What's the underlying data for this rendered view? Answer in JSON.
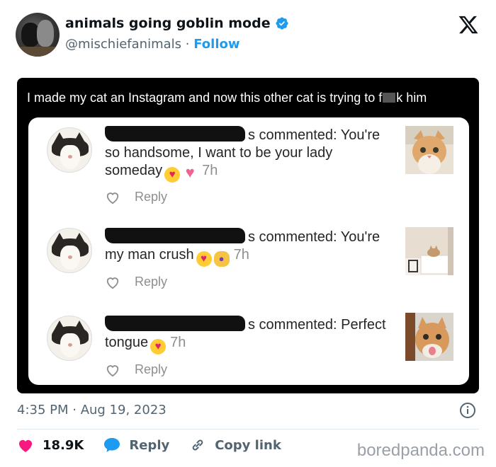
{
  "tweet": {
    "display_name": "animals going goblin mode",
    "handle": "@mischiefanimals",
    "separator": "·",
    "follow_label": "Follow",
    "timestamp": "4:35 PM · Aug 19, 2023",
    "likes": "18.9K",
    "reply_label": "Reply",
    "copy_link_label": "Copy link",
    "watermark": "boredpanda.com"
  },
  "media": {
    "title_before": "I made my cat an Instagram and now this other cat is trying to f",
    "title_after": "k him",
    "comments": [
      {
        "name_tail": "s",
        "text_line1": " commented: You're",
        "text_line2": "so handsome, I want to be your lady",
        "text_line3": "someday",
        "emojis": [
          "heart-eyes-emoji",
          "pink-heart-emoji"
        ],
        "time": "7h",
        "reply_label": "Reply"
      },
      {
        "name_tail": "s",
        "text_line1": " commented: You're",
        "text_line2": "my man crush",
        "emojis": [
          "heart-eyes-emoji",
          "tipping-hand-person-emoji"
        ],
        "time": "7h",
        "reply_label": "Reply"
      },
      {
        "name_tail": "s",
        "text_line1": " commented: Perfect",
        "text_line2": "tongue",
        "emojis": [
          "heart-eyes-emoji"
        ],
        "time": "7h",
        "reply_label": "Reply"
      }
    ]
  },
  "icons": {
    "verified": "verified-badge-icon",
    "x_logo": "x-logo-icon",
    "info": "info-icon",
    "like": "heart-icon",
    "reply": "speech-bubble-icon",
    "link": "link-icon"
  },
  "colors": {
    "accent": "#1d9bf0",
    "like": "#f91880",
    "media_bg": "#000000"
  }
}
